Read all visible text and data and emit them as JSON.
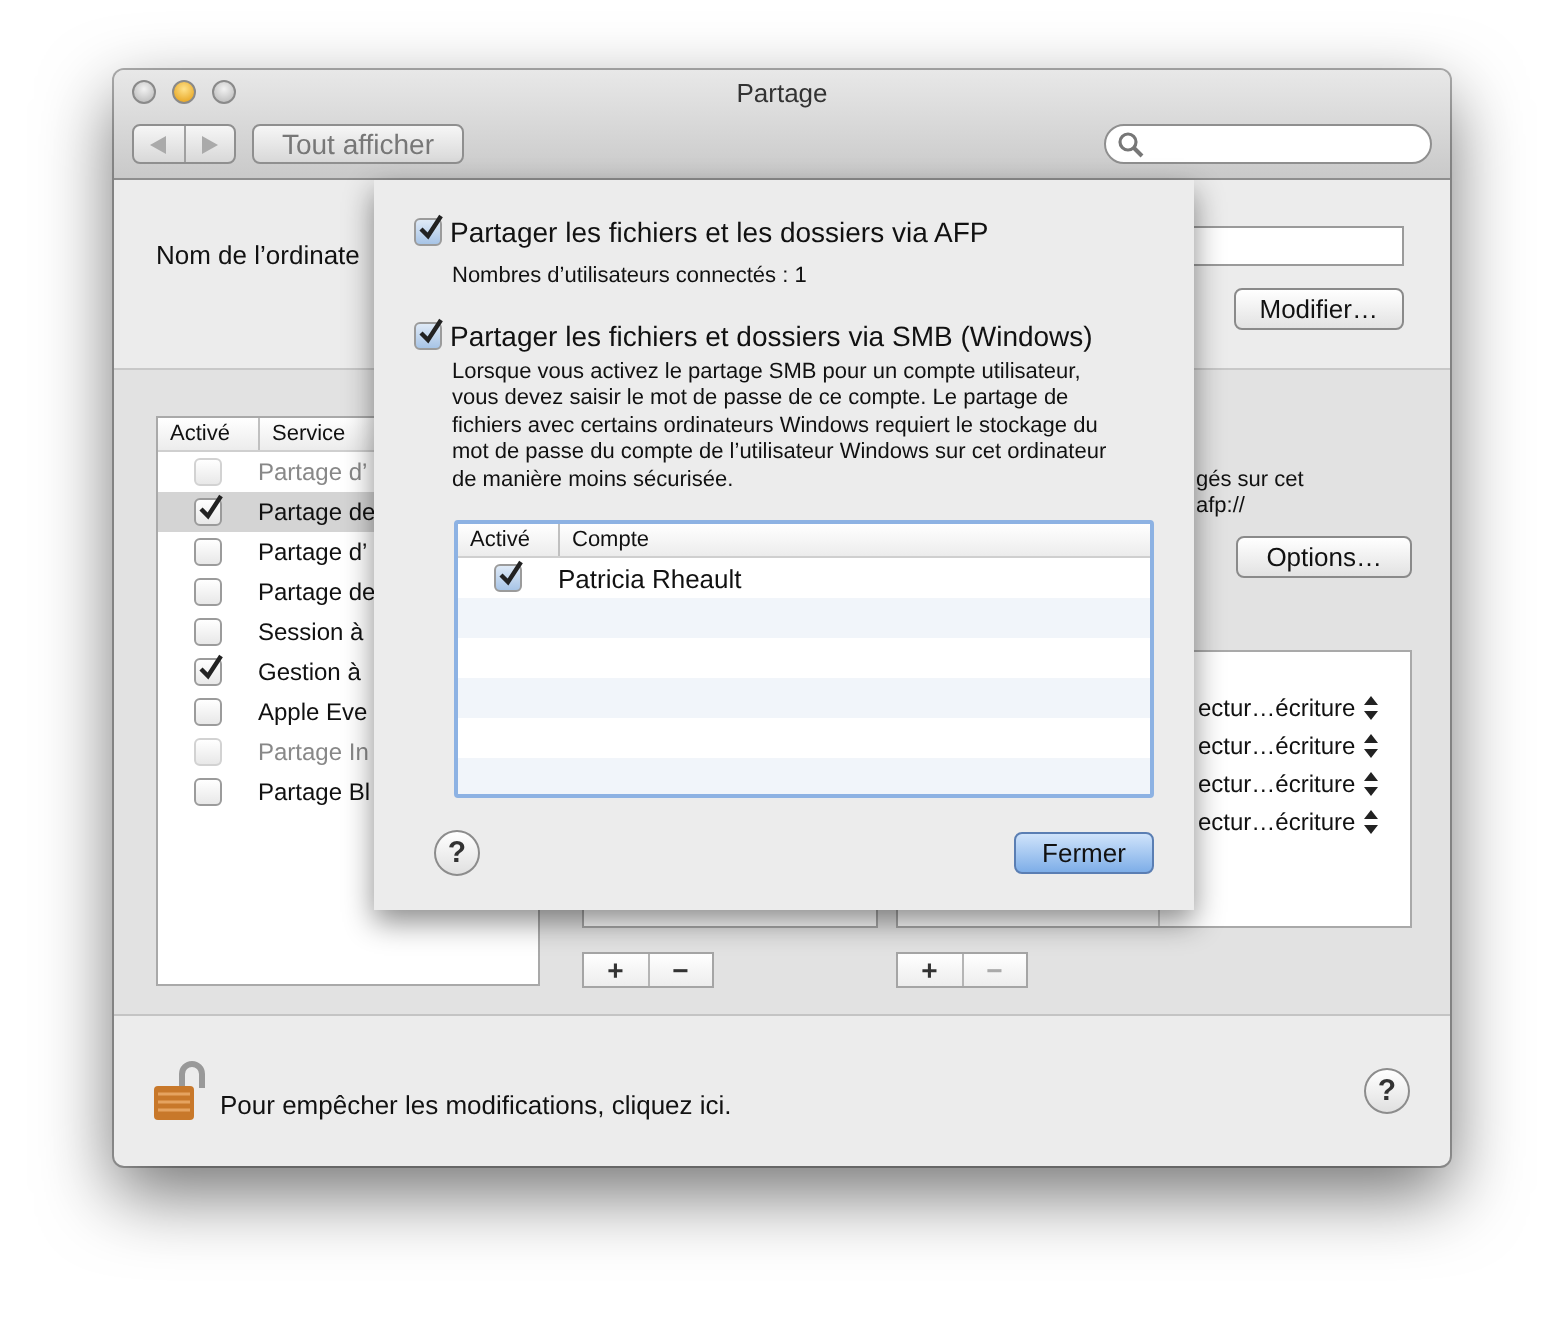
{
  "window": {
    "title": "Partage"
  },
  "toolbar": {
    "show_all": "Tout afficher"
  },
  "computer_name": {
    "label": "Nom de l’ordinate",
    "modify_button": "Modifier…"
  },
  "services": {
    "columns": [
      "Activé",
      "Service"
    ],
    "rows": [
      {
        "name": "Partage d’",
        "checked": false,
        "disabled": true,
        "selected": false
      },
      {
        "name": "Partage de",
        "checked": true,
        "disabled": false,
        "selected": true
      },
      {
        "name": "Partage d’",
        "checked": false,
        "disabled": false,
        "selected": false
      },
      {
        "name": "Partage de",
        "checked": false,
        "disabled": false,
        "selected": false
      },
      {
        "name": "Session à",
        "checked": false,
        "disabled": false,
        "selected": false
      },
      {
        "name": "Gestion à",
        "checked": true,
        "disabled": false,
        "selected": false
      },
      {
        "name": "Apple Eve",
        "checked": false,
        "disabled": false,
        "selected": false
      },
      {
        "name": "Partage In",
        "checked": false,
        "disabled": true,
        "selected": false
      },
      {
        "name": "Partage Bl",
        "checked": false,
        "disabled": false,
        "selected": false
      }
    ]
  },
  "description": [
    "gés sur cet",
    "afp://"
  ],
  "options_button": "Options…",
  "permissions": [
    "ectur…écriture",
    "ectur…écriture",
    "ectur…écriture",
    "ectur…écriture"
  ],
  "list_buttons": [
    {
      "add": "+",
      "remove": "−",
      "remove_disabled": false
    },
    {
      "add": "+",
      "remove": "−",
      "remove_disabled": true
    }
  ],
  "sheet": {
    "afp": {
      "label": "Partager les fichiers et les dossiers via AFP",
      "checked": true
    },
    "afp_users": "Nombres d’utilisateurs connectés : 1",
    "smb": {
      "label": "Partager les fichiers et dossiers via SMB (Windows)",
      "checked": true
    },
    "smb_note": "Lorsque vous activez le partage SMB pour un compte utilisateur, vous devez saisir le mot de passe de ce compte. Le partage de fichiers avec certains ordinateurs Windows requiert le stockage du mot de passe du compte de l’utilisateur Windows sur cet ordinateur de manière moins sécurisée.",
    "accounts": {
      "columns": [
        "Activé",
        "Compte"
      ],
      "rows": [
        {
          "name": "Patricia Rheault",
          "checked": true
        }
      ]
    },
    "help": "?",
    "close_button": "Fermer"
  },
  "lock_text": "Pour empêcher les modifications, cliquez ici.",
  "help": "?"
}
